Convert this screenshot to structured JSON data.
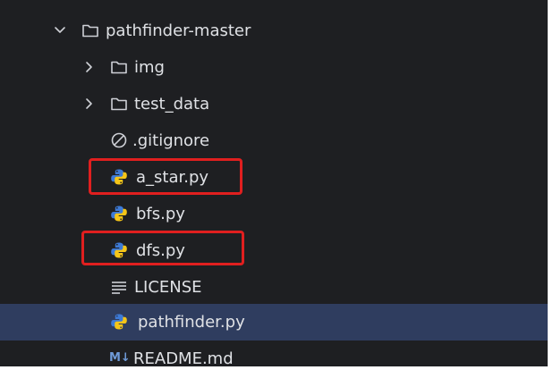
{
  "project_tree": {
    "root": {
      "label": "pathfinder-master",
      "expanded": true,
      "icon": "folder-icon"
    },
    "items": [
      {
        "label": "img",
        "kind": "folder",
        "expanded": false,
        "icon": "folder-icon"
      },
      {
        "label": "test_data",
        "kind": "folder",
        "expanded": false,
        "icon": "folder-icon"
      },
      {
        "label": ".gitignore",
        "kind": "ignore-file",
        "icon": "ignore-icon"
      },
      {
        "label": "a_star.py",
        "kind": "python-file",
        "icon": "python-icon",
        "highlighted": true
      },
      {
        "label": "bfs.py",
        "kind": "python-file",
        "icon": "python-icon"
      },
      {
        "label": "dfs.py",
        "kind": "python-file",
        "icon": "python-icon",
        "highlighted": true
      },
      {
        "label": "LICENSE",
        "kind": "text-file",
        "icon": "text-lines-icon"
      },
      {
        "label": "pathfinder.py",
        "kind": "python-file",
        "icon": "python-icon",
        "selected": true
      },
      {
        "label": "README.md",
        "kind": "markdown-file",
        "icon": "markdown-icon",
        "icon_text": "M↓"
      }
    ]
  },
  "colors": {
    "background": "#1e1f22",
    "selection": "#2f3d5f",
    "text": "#dfe1e5",
    "icon_gray": "#ced0d6",
    "python_blue": "#3d7ad6",
    "python_yellow": "#f5c518",
    "highlight_box": "#e01f1f",
    "markdown_blue": "#6f9bd8"
  }
}
